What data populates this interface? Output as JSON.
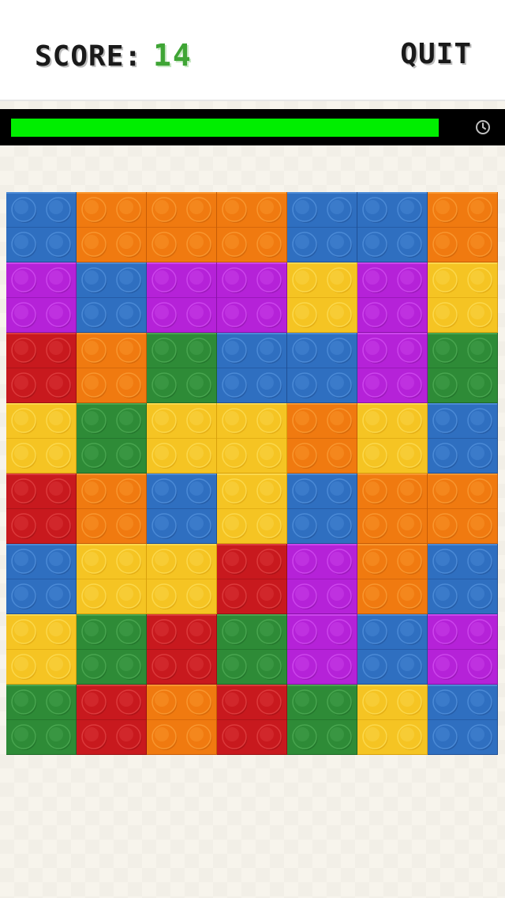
{
  "header": {
    "score_label": "SCORE:",
    "score_value": "14",
    "quit_label": "QUIT"
  },
  "timer": {
    "remaining_fraction": 0.95,
    "icon": "clock-icon",
    "fill_color": "#00ee00"
  },
  "palette": {
    "blue": {
      "base": "#2f6fc0",
      "light": "#4b8ad6",
      "dark": "#1f5096"
    },
    "orange": {
      "base": "#f07a10",
      "light": "#f8962f",
      "dark": "#c75c06"
    },
    "purple": {
      "base": "#b522d8",
      "light": "#cc45ec",
      "dark": "#8a12a8"
    },
    "yellow": {
      "base": "#f5c423",
      "light": "#fbd84c",
      "dark": "#d9a10c"
    },
    "red": {
      "base": "#c8191e",
      "light": "#dc3a3c",
      "dark": "#9a0f12"
    },
    "green": {
      "base": "#2e8b37",
      "light": "#48a54f",
      "dark": "#1e6a26"
    }
  },
  "board": {
    "rows": 8,
    "cols": 7,
    "cells": [
      [
        "blue",
        "orange",
        "orange",
        "orange",
        "blue",
        "blue",
        "orange"
      ],
      [
        "purple",
        "blue",
        "purple",
        "purple",
        "yellow",
        "purple",
        "yellow"
      ],
      [
        "red",
        "orange",
        "green",
        "blue",
        "blue",
        "purple",
        "green"
      ],
      [
        "yellow",
        "green",
        "yellow",
        "yellow",
        "orange",
        "yellow",
        "blue"
      ],
      [
        "red",
        "orange",
        "blue",
        "yellow",
        "blue",
        "orange",
        "orange"
      ],
      [
        "blue",
        "yellow",
        "yellow",
        "red",
        "purple",
        "orange",
        "blue"
      ],
      [
        "yellow",
        "green",
        "red",
        "green",
        "purple",
        "blue",
        "purple"
      ],
      [
        "green",
        "red",
        "orange",
        "red",
        "green",
        "yellow",
        "blue"
      ]
    ]
  }
}
